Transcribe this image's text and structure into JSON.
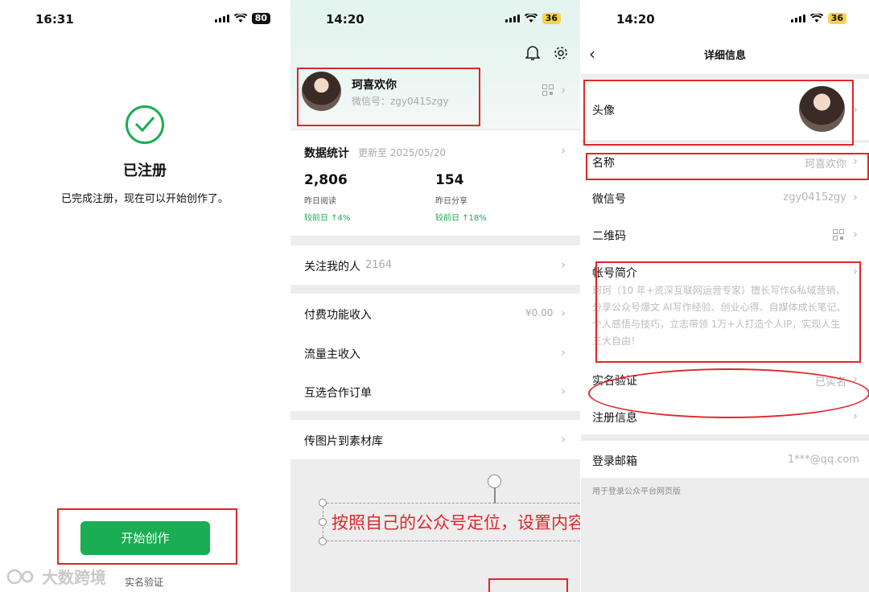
{
  "colors": {
    "accent": "#1aad53",
    "annotation": "#e0262a"
  },
  "panel1": {
    "status": {
      "time": "16:31",
      "battery": "80"
    },
    "title": "已注册",
    "subtitle": "已完成注册，现在可以开始创作了。",
    "start_button": "开始创作",
    "verify_link": "实名验证",
    "watermark": "大数跨境"
  },
  "panel2": {
    "status": {
      "time": "14:20",
      "battery": "36"
    },
    "profile": {
      "name": "珂喜欢你",
      "wechat_id": "微信号：zgy0415zgy"
    },
    "stats": {
      "title": "数据统计",
      "updated": "更新至 2025/05/20",
      "items": [
        {
          "value": "2,806",
          "label": "昨日阅读",
          "change": "较前日 ↑4%"
        },
        {
          "value": "154",
          "label": "昨日分享",
          "change": "较前日 ↑18%"
        }
      ]
    },
    "followers": {
      "label": "关注我的人",
      "count": "2164"
    },
    "menu": {
      "paid_income": {
        "label": "付费功能收入",
        "value": "¥0.00"
      },
      "traffic_income": {
        "label": "流量主收入"
      },
      "orders": {
        "label": "互选合作订单"
      },
      "upload": {
        "label": "传图片到素材库"
      }
    },
    "annotation": "按照自己的公众号定位，设置内容即可"
  },
  "panel3": {
    "status": {
      "time": "14:20",
      "battery": "36"
    },
    "title": "详细信息",
    "rows": {
      "avatar": "头像",
      "name": {
        "label": "名称",
        "value": "珂喜欢你"
      },
      "wechat_id": {
        "label": "微信号",
        "value": "zgy0415zgy"
      },
      "qrcode": {
        "label": "二维码"
      },
      "bio": {
        "label": "帐号简介",
        "text": "珂珂（10 年+资深互联网运营专家）擅长写作&私域营销，分享公众号爆文 AI写作经验、创业心得、自媒体成长笔记、个人感悟与技巧，立志带领 1万+人打造个人IP，实现人生三大自由！"
      },
      "verification": {
        "label": "实名验证",
        "value": "已实名"
      },
      "registration": {
        "label": "注册信息"
      },
      "email": {
        "label": "登录邮箱",
        "value": "1***@qq.com",
        "hint": "用于登录公众平台网页版"
      }
    }
  }
}
